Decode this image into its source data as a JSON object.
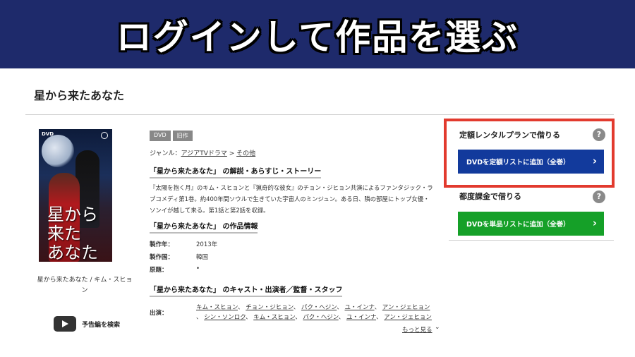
{
  "banner": {
    "title": "ログインして作品を選ぶ"
  },
  "page": {
    "title": "星から来たあなた"
  },
  "poster": {
    "title_line1": "星から来た",
    "title_line2": "あなた",
    "dvd_mark": "DVD"
  },
  "caption": "星から来たあなた / キム・スヒョン",
  "trailer": {
    "label": "予告編を検索",
    "icon": "play-icon"
  },
  "badges": [
    "DVD",
    "旧作"
  ],
  "genre": {
    "label": "ジャンル：",
    "category": "アジアTVドラマ",
    "separator": " > ",
    "subcategory": "その他"
  },
  "synopsis": {
    "heading": "「星から来たあなた」 の解説・あらすじ・ストーリー",
    "text": "『太陽を抱く月』のキム・スヒョンと『猟奇的な彼女』のチョン・ジヒョン共演によるファンタジック・ラブコメディ第1巻。約400年間ソウルで生きていた宇宙人のミンジュン。ある日、隣の部屋にトップ女優・ソンイが越して来る。第1話と第2話を収録。"
  },
  "work_info": {
    "heading": "「星から来たあなた」 の作品情報",
    "rows": [
      {
        "label": "製作年：",
        "value": "2013年"
      },
      {
        "label": "製作国：",
        "value": "韓国"
      },
      {
        "label": "原題：",
        "value": "•"
      }
    ]
  },
  "cast": {
    "heading": "「星から来たあなた」 のキャスト・出演者／監督・スタッフ",
    "label": "出演：",
    "line1": [
      "キム・スヒョン",
      "チョン・ジヒョン",
      "パク・ヘジン",
      "ユ・インナ",
      "アン・ジェヒョン"
    ],
    "line2": [
      "シン・ソンロク",
      "キム・スヒョン",
      "パク・ヘジン",
      "ユ・インナ",
      "アン・ジェヒョン"
    ],
    "separator": "、",
    "more": "もっと見る"
  },
  "rental": {
    "plan_title": "定額レンタルプランで借りる",
    "plan_button": "DVDを定額リストに追加（全巻）",
    "single_title": "都度課金で借りる",
    "single_button": "DVDを単品リストに追加（全巻）",
    "help": "?",
    "chevron": "›"
  },
  "colors": {
    "banner_bg": "#1e2a6b",
    "plan_button": "#123a9c",
    "single_button": "#15a028",
    "highlight_frame": "#e23a2e"
  }
}
